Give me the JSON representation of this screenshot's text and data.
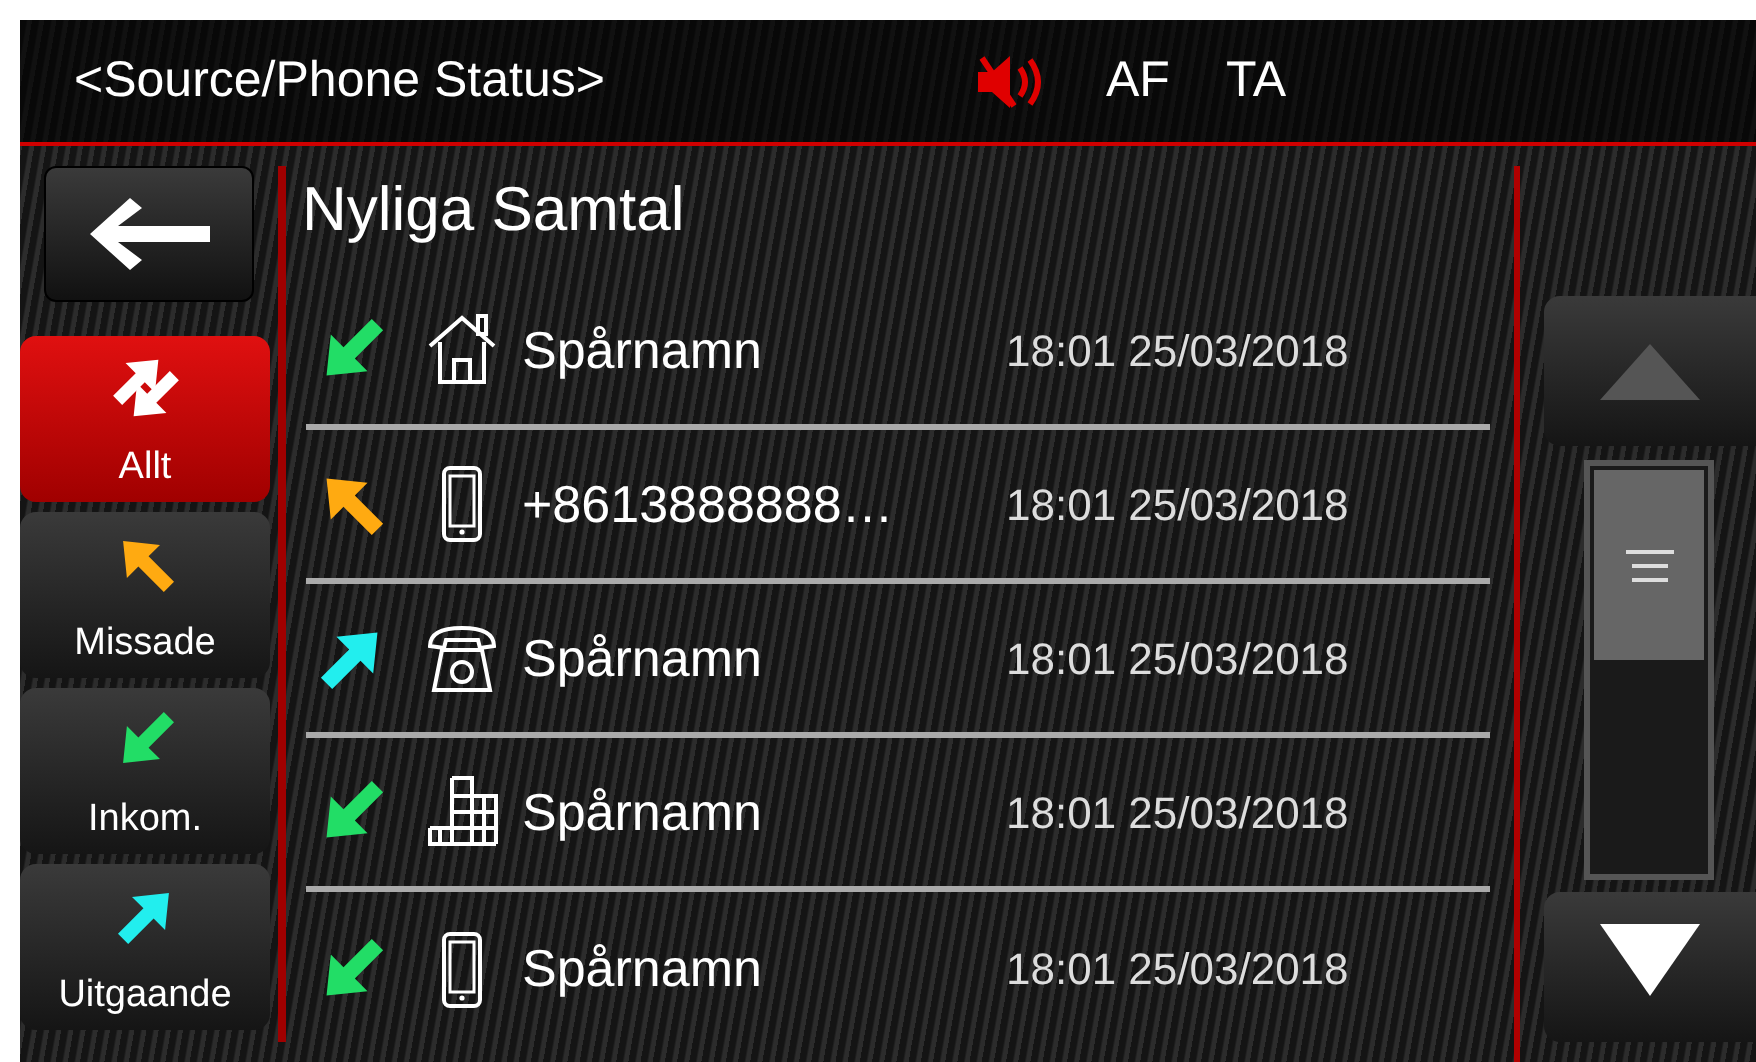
{
  "status_bar": {
    "source": "<Source/Phone Status>",
    "muted": true,
    "af": "AF",
    "ta": "TA"
  },
  "title": "Nyliga Samtal",
  "tabs": [
    {
      "label": "Allt",
      "kind": "all",
      "selected": true
    },
    {
      "label": "Missade",
      "kind": "missed",
      "selected": false
    },
    {
      "label": "Inkom.",
      "kind": "incoming",
      "selected": false
    },
    {
      "label": "Uitgaande",
      "kind": "outgoing",
      "selected": false
    }
  ],
  "calls": [
    {
      "direction": {
        "kind": "incoming"
      },
      "contact": {
        "kind": "home"
      },
      "name": "Spårnamn",
      "time": "18:01 25/03/2018"
    },
    {
      "direction": {
        "kind": "missed"
      },
      "contact": {
        "kind": "mobile"
      },
      "name": "+8613888888…",
      "time": "18:01 25/03/2018"
    },
    {
      "direction": {
        "kind": "outgoing"
      },
      "contact": {
        "kind": "landline"
      },
      "name": "Spårnamn",
      "time": "18:01 25/03/2018"
    },
    {
      "direction": {
        "kind": "incoming"
      },
      "contact": {
        "kind": "office"
      },
      "name": "Spårnamn",
      "time": "18:01 25/03/2018"
    },
    {
      "direction": {
        "kind": "incoming"
      },
      "contact": {
        "kind": "mobile"
      },
      "name": "Spårnamn",
      "time": "18:01 25/03/2018"
    }
  ],
  "scroll_up": {
    "disabled": true
  },
  "scroll_down": {
    "disabled": false
  }
}
